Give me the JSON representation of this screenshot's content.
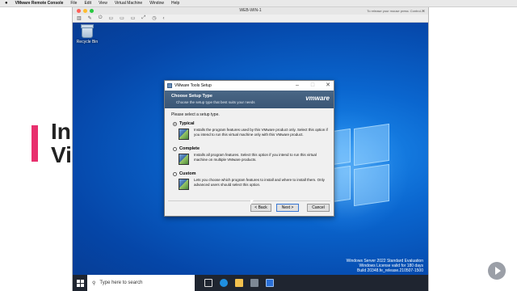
{
  "slide": {
    "accent": "#e8306e",
    "title_line1": "In",
    "title_line2": "Vi"
  },
  "macbar": {
    "app": "VMware Remote Console",
    "menus": [
      "File",
      "Edit",
      "View",
      "Virtual Machine",
      "Window",
      "Help"
    ]
  },
  "window": {
    "title": "WEB-WIN-1",
    "release_hint": "To release your mouse press: Control-⌘",
    "lights": [
      "#ff5f57",
      "#febc2e",
      "#28c840"
    ]
  },
  "desktop": {
    "recycle_bin": "Recycle Bin",
    "watermark": [
      "Windows Server 2022 Standard Evaluation",
      "Windows License valid for 180 days",
      "Build 20348.fe_release.210507-1500"
    ]
  },
  "taskbar": {
    "search_placeholder": "Type here to search"
  },
  "dialog": {
    "title": "VMware Tools Setup",
    "header": "Choose Setup Type",
    "subheader": "Choose the setup type that best suits your needs",
    "brand": "vmware",
    "prompt": "Please select a setup type.",
    "options": [
      {
        "label": "Typical",
        "selected": true,
        "desc": "Installs the program features used by this VMware product only.  Select this option if you intend to run this virtual machine only with this VMware product."
      },
      {
        "label": "Complete",
        "selected": false,
        "desc": "Installs all program features.  Select this option if you intend to run this virtual machine on multiple VMware products."
      },
      {
        "label": "Custom",
        "selected": false,
        "desc": "Lets you choose which program features to install and where to install them.  Only advanced users should select this option."
      }
    ],
    "buttons": {
      "back": "< Back",
      "next": "Next >",
      "cancel": "Cancel"
    }
  }
}
